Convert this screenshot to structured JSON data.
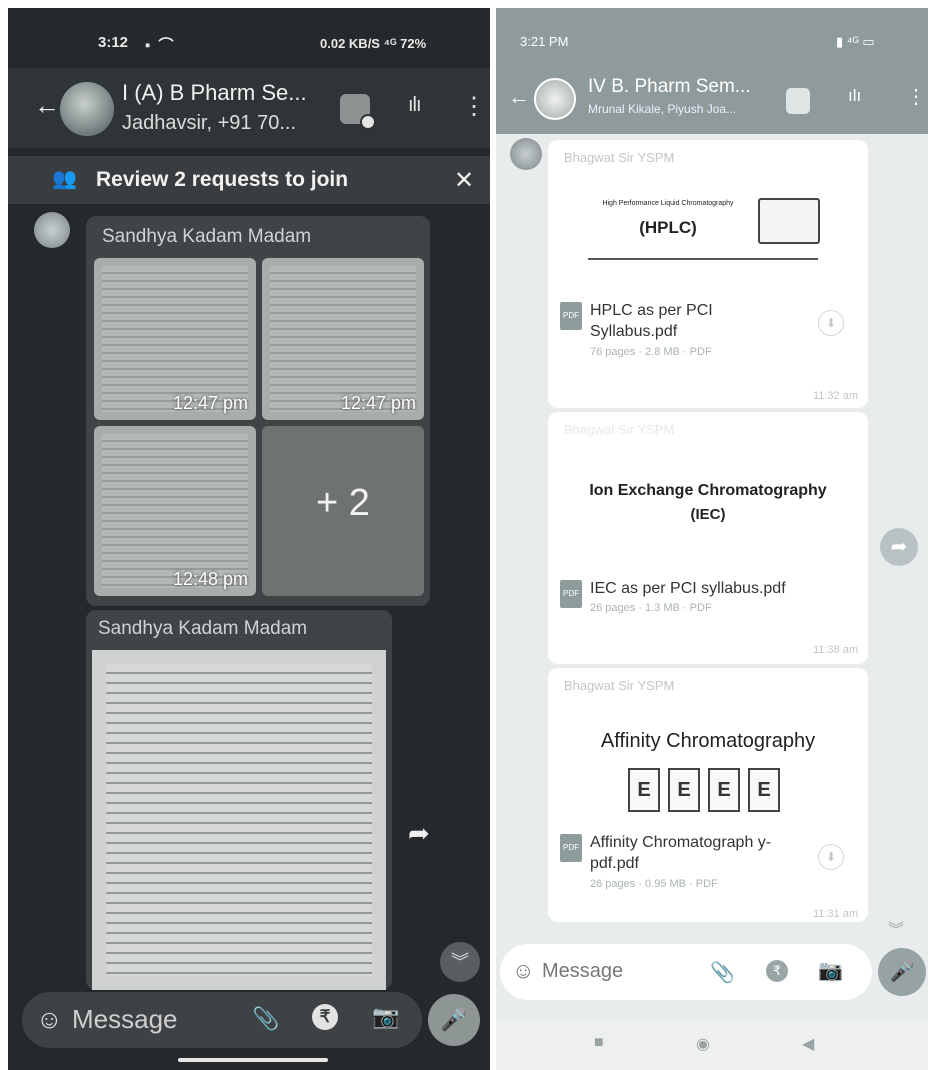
{
  "left_phone": {
    "status": {
      "time": "3:12",
      "indicators": "0.02 KB/S  ⁴ᴳ  72%"
    },
    "header": {
      "title": "I (A) B Pharm Se...",
      "subtitle": "Jadhavsir, +91 70..."
    },
    "review_banner": {
      "text": "Review 2 requests to join"
    },
    "messages": [
      {
        "sender": "Sandhya Kadam Madam",
        "thumbnails": [
          {
            "time": "12:47 pm"
          },
          {
            "time": "12:47 pm"
          },
          {
            "time": "12:48 pm"
          },
          {
            "more": "+ 2"
          }
        ]
      },
      {
        "sender": "Sandhya Kadam Madam"
      }
    ],
    "input": {
      "placeholder": "Message",
      "rupee": "₹"
    }
  },
  "right_phone": {
    "status": {
      "time": "3:21 PM"
    },
    "header": {
      "title": "IV B. Pharm Sem...",
      "subtitle": "Mrunal Kikale, Piyush Joa..."
    },
    "messages": [
      {
        "sender": "Bhagwat Sir YSPM",
        "preview_heading": "High Performance Liquid Chromatography",
        "preview_title": "(HPLC)",
        "file_name": "HPLC as per PCI Syllabus.pdf",
        "file_meta": "76 pages · 2.8 MB · PDF",
        "time": "11:32 am"
      },
      {
        "sender": "Bhagwat Sir YSPM",
        "preview_title": "Ion Exchange Chromatography",
        "preview_subtitle": "(IEC)",
        "file_name": "IEC as per PCI syllabus.pdf",
        "file_meta": "26 pages · 1.3 MB · PDF",
        "time": "11:38 am"
      },
      {
        "sender": "Bhagwat Sir YSPM",
        "preview_title": "Affinity Chromatography",
        "column_labels": [
          "E",
          "E",
          "E",
          "E"
        ],
        "file_name": "Affinity Chromatograph y-pdf.pdf",
        "file_meta": "26 pages · 0.95 MB · PDF",
        "time": "11:31 am"
      }
    ],
    "input": {
      "placeholder": "Message",
      "rupee": "₹"
    }
  },
  "icons": {
    "back": "←",
    "kebab": "⋮",
    "wave": "ılı",
    "close": "✕",
    "forward": "➦",
    "emoji": "☺",
    "clip": "📎",
    "camera": "📷",
    "mic": "🎤",
    "scroll_down": "︾",
    "download": "⬇",
    "nav_square": "■",
    "nav_circle": "◉",
    "nav_back": "◀"
  },
  "colors": {
    "left_bg": "#26292b",
    "right_header": "#8f9a9a"
  }
}
